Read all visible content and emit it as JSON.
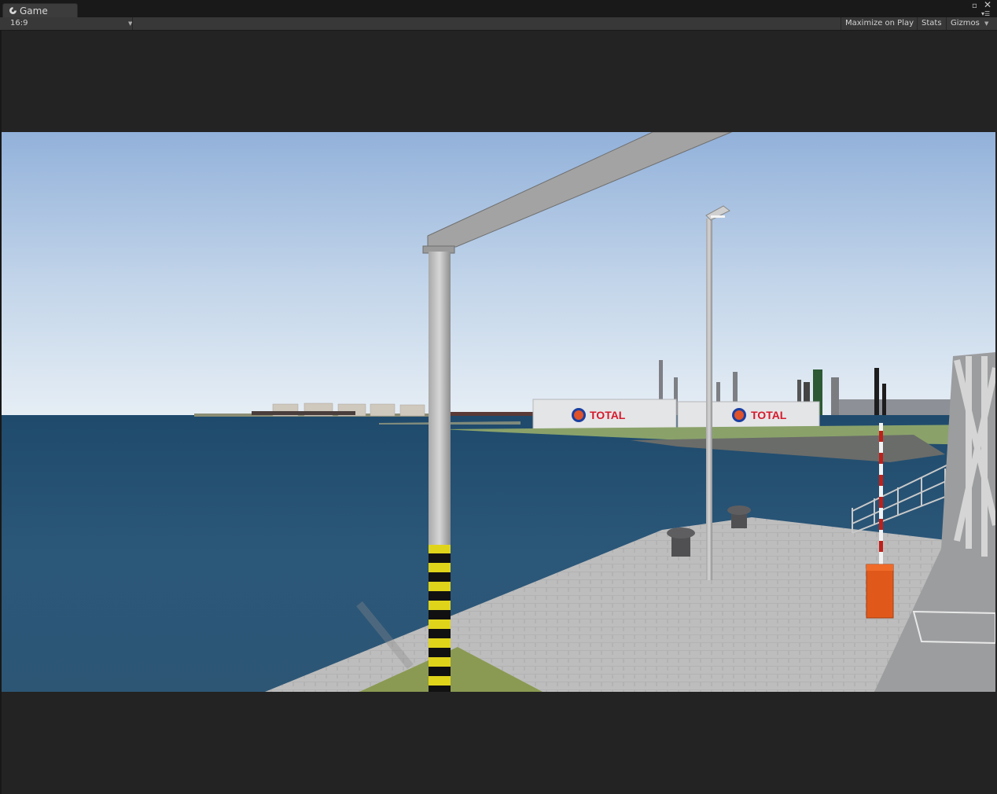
{
  "window": {
    "tab_title": "Game",
    "tab_icon": "unity-game-icon"
  },
  "toolbar": {
    "aspect_ratio": "16:9",
    "maximize_label": "Maximize on Play",
    "stats_label": "Stats",
    "gizmos_label": "Gizmos"
  },
  "scene": {
    "tank_brand_left": "TOTAL",
    "tank_brand_right": "TOTAL",
    "sky_top": "#9ab6dc",
    "sky_bottom": "#e3ecf5",
    "water_color": "#2a5577",
    "pavement_color": "#b8b8b8",
    "brand_color": "#d7192b"
  }
}
